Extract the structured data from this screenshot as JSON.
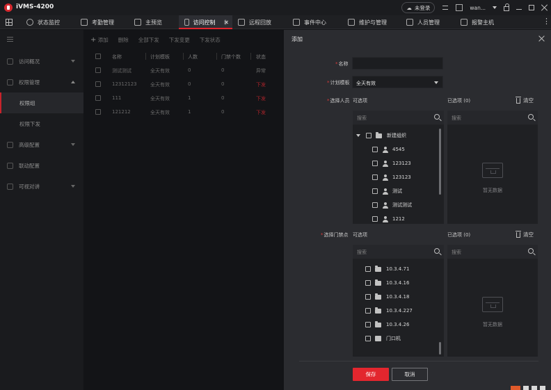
{
  "app": {
    "title": "iVMS-4200",
    "login_status": "未登录",
    "user": "wan..."
  },
  "nav": {
    "tabs": [
      {
        "label": "状态监控"
      },
      {
        "label": "考勤管理"
      },
      {
        "label": "主预览"
      },
      {
        "label": "访问控制"
      },
      {
        "label": "远程回放"
      },
      {
        "label": "事件中心"
      },
      {
        "label": "维护与管理"
      },
      {
        "label": "人员管理"
      },
      {
        "label": "报警主机"
      }
    ]
  },
  "sidebar": {
    "items": [
      {
        "label": "访问概况"
      },
      {
        "label": "权限管理"
      },
      {
        "label": "权限组"
      },
      {
        "label": "权限下发"
      },
      {
        "label": "高级配置"
      },
      {
        "label": "联动配置"
      },
      {
        "label": "可视对讲"
      }
    ]
  },
  "toolbar": {
    "add": "添加",
    "delete": "删除",
    "apply_all": "全部下发",
    "apply_changes": "下发变更",
    "status": "下发状态"
  },
  "table": {
    "headers": [
      "名称",
      "计划模板",
      "人数",
      "门禁个数",
      "状态"
    ],
    "rows": [
      {
        "name": "测试测试",
        "template": "全天有效",
        "people": "0",
        "doors": "0",
        "status": "异常"
      },
      {
        "name": "12312123",
        "template": "全天有效",
        "people": "0",
        "doors": "0",
        "status": "下发"
      },
      {
        "name": "111",
        "template": "全天有效",
        "people": "1",
        "doors": "0",
        "status": "下发"
      },
      {
        "name": "121212",
        "template": "全天有效",
        "people": "1",
        "doors": "0",
        "status": "下发"
      }
    ]
  },
  "modal": {
    "title": "添加",
    "name_label": "名称",
    "name_value": "",
    "template_label": "计划模板",
    "template_value": "全天有效",
    "person_label": "选择人员",
    "door_label": "选择门禁点",
    "available": "可选项",
    "selected": "已选项 (0)",
    "clear": "清空",
    "search_placeholder": "搜索",
    "empty": "暂无数据",
    "person_tree": {
      "group": "新建组织",
      "people": [
        "4545",
        "123123",
        "123123",
        "测试",
        "测试测试",
        "1212"
      ]
    },
    "doors": [
      "10.3.4.71",
      "10.3.4.16",
      "10.3.4.18",
      "10.3.4.227",
      "10.3.4.26",
      "门口机"
    ],
    "save": "保存",
    "cancel": "取消"
  },
  "colors": {
    "accent": "#e3262e",
    "bg": "#141518",
    "modal_bg": "#2b2c30"
  }
}
